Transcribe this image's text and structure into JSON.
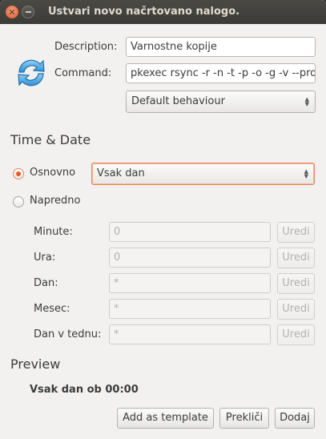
{
  "window": {
    "title": "Ustvari novo načrtovano nalogo."
  },
  "form": {
    "description_label": "Description:",
    "description_value": "Varnostne kopije",
    "command_label": "Command:",
    "command_value": "pkexec rsync -r -n -t -p -o -g -v --prog",
    "behaviour_value": "Default behaviour"
  },
  "time_date": {
    "heading": "Time & Date",
    "basic_label": "Osnovno",
    "basic_value": "Vsak dan",
    "advanced_label": "Napredno",
    "fields": [
      {
        "label": "Minute:",
        "value": "0",
        "edit": "Uredi"
      },
      {
        "label": "Ura:",
        "value": "0",
        "edit": "Uredi"
      },
      {
        "label": "Dan:",
        "value": "*",
        "edit": "Uredi"
      },
      {
        "label": "Mesec:",
        "value": "*",
        "edit": "Uredi"
      },
      {
        "label": "Dan v tednu:",
        "value": "*",
        "edit": "Uredi"
      }
    ]
  },
  "preview": {
    "heading": "Preview",
    "text": "Vsak dan ob 00:00"
  },
  "buttons": {
    "add_template": "Add as template",
    "cancel": "Prekliči",
    "add": "Dodaj"
  },
  "colors": {
    "accent": "#e65a1f",
    "titlebar": "#3c3b37"
  }
}
